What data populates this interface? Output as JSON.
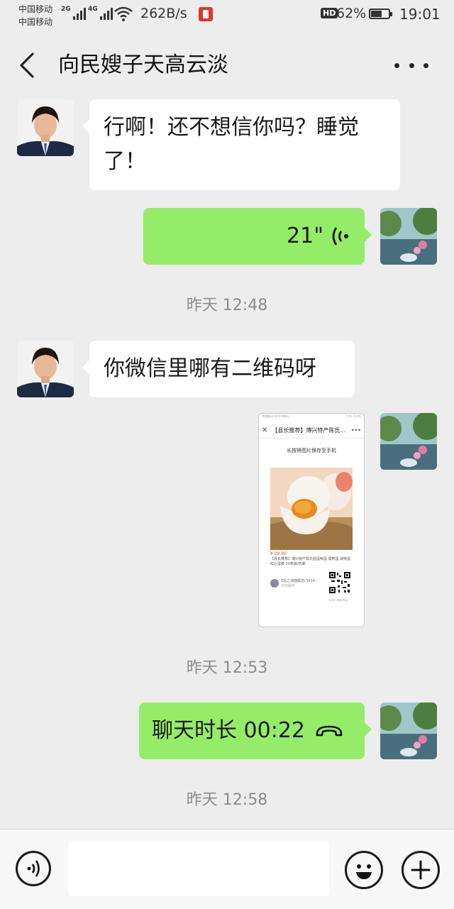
{
  "status_bar": {
    "carrier_1": "中国移动",
    "carrier_2": "中国移动",
    "signal_1_label": "2G",
    "signal_2_label": "4G",
    "net_speed": "262B/s",
    "hd_badge": "HD",
    "battery_percent": "62%",
    "battery_level": 0.62,
    "time": "19:01"
  },
  "header": {
    "back_icon": "chevron-left-icon",
    "title": "向民嫂子天高云淡",
    "more_icon": "more-horizontal-icon"
  },
  "messages": [
    {
      "type": "text",
      "side": "left",
      "text": "行啊！还不想信你吗？睡觉了！"
    },
    {
      "type": "voice",
      "side": "right",
      "duration": "21\""
    },
    {
      "type": "timestamp",
      "text": "昨天 12:48"
    },
    {
      "type": "text",
      "side": "left",
      "text": "你微信里哪有二维码呀"
    },
    {
      "type": "image",
      "side": "right",
      "image": {
        "status": "中国移动 all 0.00K/s",
        "status_right": "71% 12:01",
        "nav_title": "【县长推荐】博兴特产陈氏...",
        "hint": "长按将图片保存至手机",
        "price": "¥ 29.90",
        "description": "【县长推荐】博兴特产陈氏盐蛋鸭蛋 咸鸭蛋 咸鸭蛋 红心蛋黄 20枚装/包邮",
        "shop": "E站之道旗舰店(3914...",
        "shop_sub": "识别图中",
        "footer": "长按二维码购买"
      }
    },
    {
      "type": "timestamp",
      "text": "昨天 12:53"
    },
    {
      "type": "call",
      "side": "right",
      "text": "聊天时长 00:22"
    },
    {
      "type": "timestamp",
      "text": "昨天 12:58"
    }
  ],
  "colors": {
    "background": "#ededed",
    "self_bubble": "#95ec69",
    "other_bubble": "#ffffff",
    "timestamp": "#8c8c8c"
  },
  "input_bar": {
    "voice_icon": "voice-input-icon",
    "text_value": "",
    "emoji_icon": "emoji-icon",
    "plus_icon": "plus-icon"
  }
}
